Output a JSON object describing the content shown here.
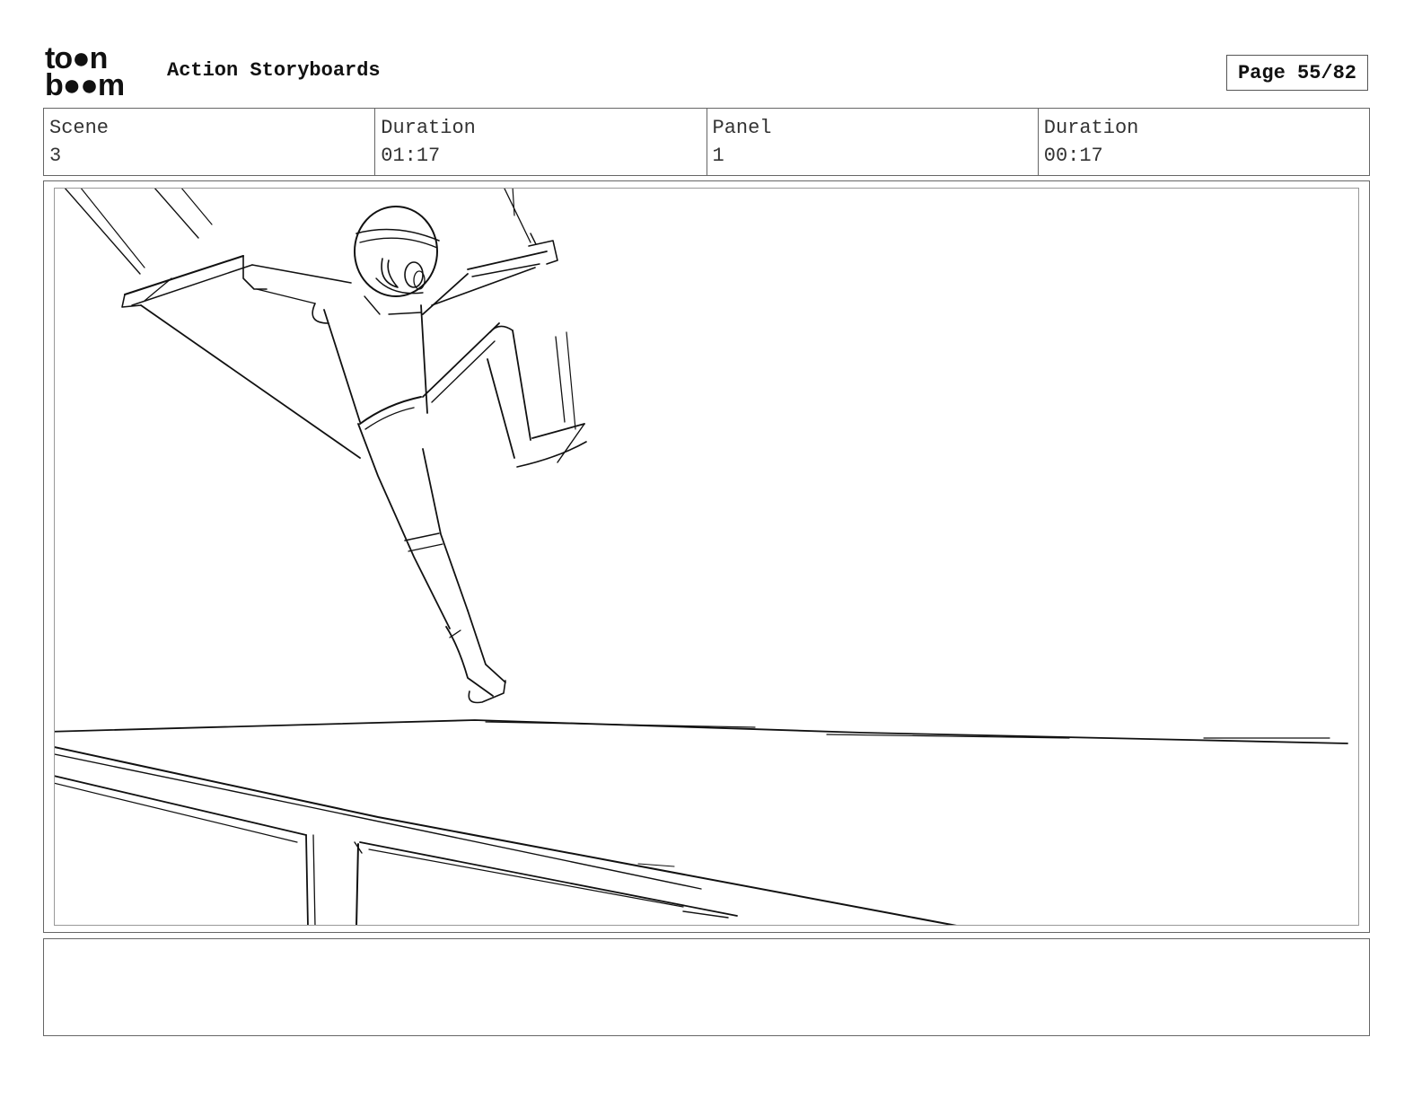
{
  "header": {
    "logo_top": "to●n",
    "logo_bottom": "b●●m",
    "app_title": "Action Storyboards",
    "page_label": "Page 55/82"
  },
  "info": {
    "scene_label": "Scene",
    "scene_value": "3",
    "scene_duration_label": "Duration",
    "scene_duration_value": "01:17",
    "panel_label": "Panel",
    "panel_value": "1",
    "panel_duration_label": "Duration",
    "panel_duration_value": "00:17"
  },
  "notes": {
    "text": ""
  }
}
